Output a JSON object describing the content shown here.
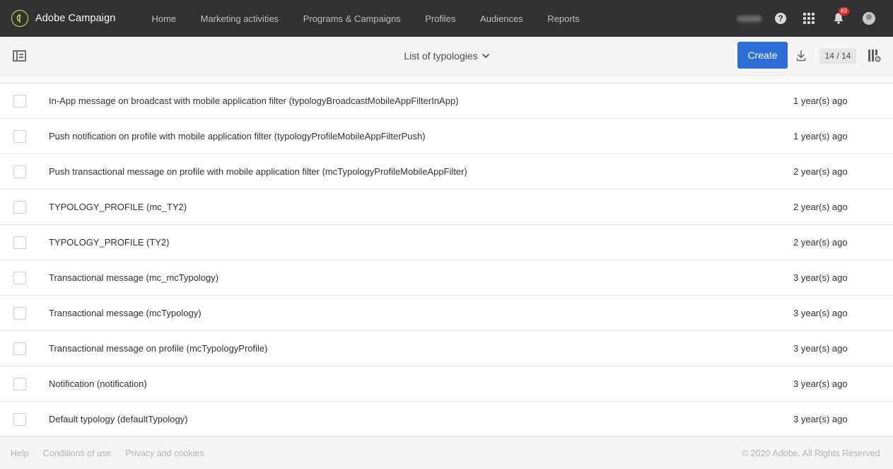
{
  "app": {
    "name": "Adobe Campaign"
  },
  "nav": {
    "links": [
      "Home",
      "Marketing activities",
      "Programs & Campaigns",
      "Profiles",
      "Audiences",
      "Reports"
    ],
    "notification_count": "83"
  },
  "toolbar": {
    "title": "List of typologies",
    "create_label": "Create",
    "count": "14 / 14"
  },
  "rows": [
    {
      "label": "In-App message on broadcast with mobile application filter (typologyBroadcastMobileAppFilterInApp)",
      "date": "1 year(s) ago"
    },
    {
      "label": "Push notification on profile with mobile application filter (typologyProfileMobileAppFilterPush)",
      "date": "1 year(s) ago"
    },
    {
      "label": "Push transactional message on profile with mobile application filter (mcTypologyProfileMobileAppFilter)",
      "date": "2 year(s) ago"
    },
    {
      "label": "TYPOLOGY_PROFILE (mc_TY2)",
      "date": "2 year(s) ago"
    },
    {
      "label": "TYPOLOGY_PROFILE (TY2)",
      "date": "2 year(s) ago"
    },
    {
      "label": "Transactional message (mc_mcTypology)",
      "date": "3 year(s) ago"
    },
    {
      "label": "Transactional message (mcTypology)",
      "date": "3 year(s) ago"
    },
    {
      "label": "Transactional message on profile (mcTypologyProfile)",
      "date": "3 year(s) ago"
    },
    {
      "label": "Notification (notification)",
      "date": "3 year(s) ago"
    },
    {
      "label": "Default typology (defaultTypology)",
      "date": "3 year(s) ago"
    }
  ],
  "footer": {
    "links": [
      "Help",
      "Conditions of use",
      "Privacy and cookies"
    ],
    "copyright": "© 2020 Adobe. All Rights Reserved."
  },
  "colors": {
    "nav_bg": "#323232",
    "primary": "#2d6fd6",
    "badge": "#e02b2b",
    "logo_accent": "#d7e34a"
  }
}
